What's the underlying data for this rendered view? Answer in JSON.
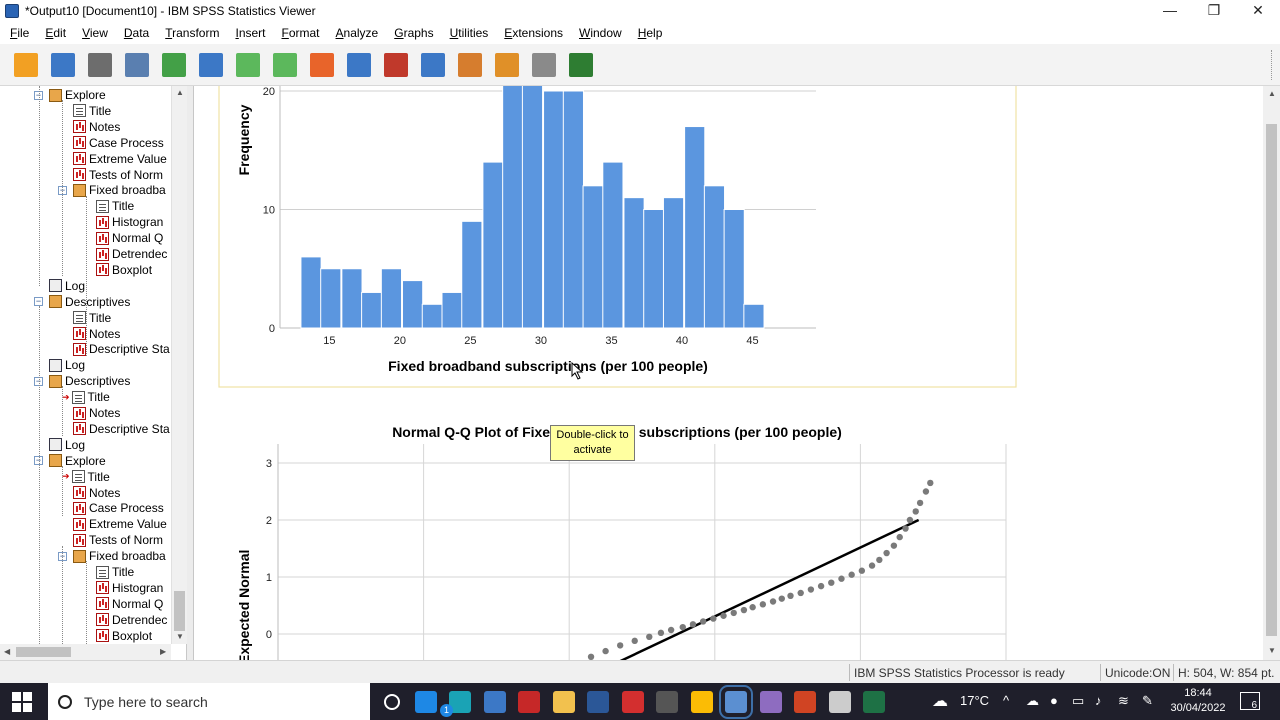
{
  "window": {
    "title": "*Output10 [Document10] - IBM SPSS Statistics Viewer",
    "controls": {
      "minimize": "—",
      "restore": "❐",
      "close": "✕"
    }
  },
  "menu": [
    "File",
    "Edit",
    "View",
    "Data",
    "Transform",
    "Insert",
    "Format",
    "Analyze",
    "Graphs",
    "Utilities",
    "Extensions",
    "Window",
    "Help"
  ],
  "toolbar_icons": [
    "open-icon",
    "save-icon",
    "print-icon",
    "print-preview-icon",
    "export-icon",
    "recall-dialog-icon",
    "undo-icon",
    "redo-icon",
    "goto-data-icon",
    "goto-case-icon",
    "goto-variable-icon",
    "variables-icon",
    "create-edit-autoscript-icon",
    "run-script-icon",
    "designate-window-icon",
    "add-icon"
  ],
  "toolbar_colors": [
    "#f2a023",
    "#3c78c6",
    "#6d6d6d",
    "#5a7fb0",
    "#43a047",
    "#3c78c6",
    "#5cb85c",
    "#5cb85c",
    "#e8642a",
    "#3c78c6",
    "#c0392b",
    "#3c78c6",
    "#d67d2e",
    "#e09028",
    "#8a8a8a",
    "#2e7d32"
  ],
  "outline": [
    {
      "label": "Explore",
      "kind": "book",
      "level": 1,
      "expander": "−"
    },
    {
      "label": "Title",
      "kind": "doc",
      "level": 2
    },
    {
      "label": "Notes",
      "kind": "chart",
      "level": 2
    },
    {
      "label": "Case Process",
      "kind": "chart",
      "level": 2
    },
    {
      "label": "Extreme Value",
      "kind": "chart",
      "level": 2
    },
    {
      "label": "Tests of Norm",
      "kind": "chart",
      "level": 2
    },
    {
      "label": "Fixed broadba",
      "kind": "book",
      "level": 2,
      "expander": "−"
    },
    {
      "label": "Title",
      "kind": "doc",
      "level": 3
    },
    {
      "label": "Histogran",
      "kind": "chart",
      "level": 3
    },
    {
      "label": "Normal Q",
      "kind": "chart",
      "level": 3
    },
    {
      "label": "Detrendec",
      "kind": "chart",
      "level": 3
    },
    {
      "label": "Boxplot",
      "kind": "chart",
      "level": 3
    },
    {
      "label": "Log",
      "kind": "log",
      "level": 1
    },
    {
      "label": "Descriptives",
      "kind": "book",
      "level": 1,
      "expander": "−"
    },
    {
      "label": "Title",
      "kind": "doc",
      "level": 2
    },
    {
      "label": "Notes",
      "kind": "chart",
      "level": 2
    },
    {
      "label": "Descriptive Sta",
      "kind": "chart",
      "level": 2
    },
    {
      "label": "Log",
      "kind": "log",
      "level": 1
    },
    {
      "label": "Descriptives",
      "kind": "book",
      "level": 1,
      "expander": "−"
    },
    {
      "label": "Title",
      "kind": "doc",
      "level": 2,
      "arrow": true
    },
    {
      "label": "Notes",
      "kind": "chart",
      "level": 2
    },
    {
      "label": "Descriptive Sta",
      "kind": "chart",
      "level": 2
    },
    {
      "label": "Log",
      "kind": "log",
      "level": 1
    },
    {
      "label": "Explore",
      "kind": "book",
      "level": 1,
      "expander": "−"
    },
    {
      "label": "Title",
      "kind": "doc",
      "level": 2,
      "arrow": true
    },
    {
      "label": "Notes",
      "kind": "chart",
      "level": 2
    },
    {
      "label": "Case Process",
      "kind": "chart",
      "level": 2
    },
    {
      "label": "Extreme Value",
      "kind": "chart",
      "level": 2
    },
    {
      "label": "Tests of Norm",
      "kind": "chart",
      "level": 2
    },
    {
      "label": "Fixed broadba",
      "kind": "book",
      "level": 2,
      "expander": "−"
    },
    {
      "label": "Title",
      "kind": "doc",
      "level": 3
    },
    {
      "label": "Histogran",
      "kind": "chart",
      "level": 3
    },
    {
      "label": "Normal Q",
      "kind": "chart",
      "level": 3
    },
    {
      "label": "Detrendec",
      "kind": "chart",
      "level": 3
    },
    {
      "label": "Boxplot",
      "kind": "chart",
      "level": 3
    }
  ],
  "tooltip": {
    "line1": "Double-click to",
    "line2": "activate"
  },
  "chart_data": [
    {
      "type": "bar",
      "title": "",
      "xlabel": "Fixed broadband subscriptions (per 100 people)",
      "ylabel": "Frequency",
      "bin_width": 1.43,
      "x_first_bin_start": 13.0,
      "x": [
        13.7,
        15.1,
        16.6,
        18.0,
        19.4,
        20.9,
        22.3,
        23.7,
        25.1,
        26.6,
        28.0,
        29.4,
        30.9,
        32.3,
        33.7,
        35.1,
        36.6,
        38.0,
        39.4,
        40.9,
        42.3,
        43.7,
        45.1
      ],
      "values": [
        6,
        5,
        5,
        3,
        5,
        4,
        2,
        3,
        9,
        14,
        21,
        21,
        20,
        20,
        12,
        14,
        11,
        10,
        11,
        17,
        12,
        10,
        2
      ],
      "xticks": [
        15,
        20,
        25,
        30,
        35,
        40,
        45
      ],
      "yticks": [
        0,
        10,
        20
      ],
      "xlim": [
        11.5,
        49.5
      ],
      "ylim": [
        0,
        20
      ],
      "bar_color": "#5b96df",
      "grid": true
    },
    {
      "type": "scatter",
      "title": "Normal Q-Q Plot of Fixed broadband subscriptions (per 100 people)",
      "ylabel": "Expected Normal",
      "yticks": [
        0,
        1,
        2,
        3
      ],
      "xlim": [
        0,
        50
      ],
      "ylim": [
        -0.5,
        3.3
      ],
      "reference_line": {
        "x": [
          20,
          44
        ],
        "y": [
          -0.9,
          2.0
        ]
      },
      "points": [
        [
          21.5,
          -0.4
        ],
        [
          22.5,
          -0.3
        ],
        [
          23.5,
          -0.2
        ],
        [
          24.5,
          -0.12
        ],
        [
          25.5,
          -0.05
        ],
        [
          26.3,
          0.02
        ],
        [
          27.0,
          0.07
        ],
        [
          27.8,
          0.12
        ],
        [
          28.5,
          0.17
        ],
        [
          29.2,
          0.22
        ],
        [
          29.9,
          0.27
        ],
        [
          30.6,
          0.32
        ],
        [
          31.3,
          0.37
        ],
        [
          32.0,
          0.42
        ],
        [
          32.6,
          0.47
        ],
        [
          33.3,
          0.52
        ],
        [
          34.0,
          0.57
        ],
        [
          34.6,
          0.62
        ],
        [
          35.2,
          0.67
        ],
        [
          35.9,
          0.72
        ],
        [
          36.6,
          0.78
        ],
        [
          37.3,
          0.84
        ],
        [
          38.0,
          0.9
        ],
        [
          38.7,
          0.97
        ],
        [
          39.4,
          1.04
        ],
        [
          40.1,
          1.11
        ],
        [
          40.8,
          1.2
        ],
        [
          41.3,
          1.3
        ],
        [
          41.8,
          1.42
        ],
        [
          42.3,
          1.55
        ],
        [
          42.7,
          1.7
        ],
        [
          43.1,
          1.85
        ],
        [
          43.4,
          2.0
        ],
        [
          43.8,
          2.15
        ],
        [
          44.1,
          2.3
        ],
        [
          44.5,
          2.5
        ],
        [
          44.8,
          2.65
        ]
      ],
      "point_color": "#7a7a7a",
      "line_color": "#000000",
      "grid": true
    }
  ],
  "status": {
    "processor": "IBM SPSS Statistics Processor is ready",
    "unicode": "Unicode:ON",
    "size": "H: 504, W: 854 pt."
  },
  "taskbar": {
    "search_placeholder": "Type here to search",
    "apps": [
      "cortana-icon",
      "mail-icon",
      "edge-icon",
      "store-icon",
      "mendeley-icon",
      "file-explorer-icon",
      "word-icon",
      "acrobat-icon",
      "calculator-icon",
      "chrome-icon",
      "spss-icon",
      "eclipse-icon",
      "powerpoint-icon",
      "app-icon",
      "excel-icon"
    ],
    "app_colors": [
      "#ffffff",
      "#1e88e5",
      "#1aa3b5",
      "#3c78c6",
      "#c62828",
      "#f2c14e",
      "#2b5797",
      "#d32f2f",
      "#555555",
      "#fbbc05",
      "#5b8fd1",
      "#8e6cc0",
      "#d04423",
      "#cccccc",
      "#1e7145"
    ],
    "weather": "17°C",
    "mail_badge": "1",
    "time": "18:44",
    "date": "30/04/2022",
    "notification_count": "6"
  }
}
